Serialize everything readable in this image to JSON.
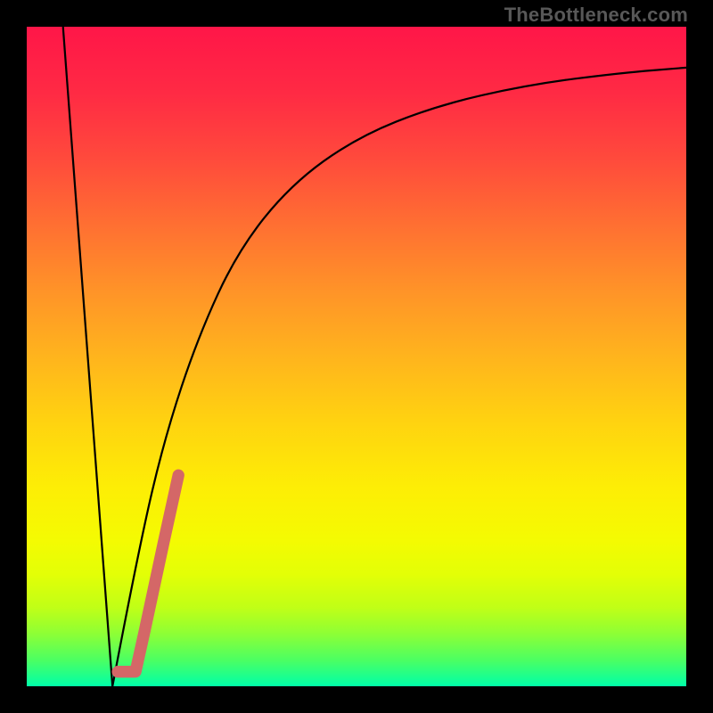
{
  "watermark": "TheBottleneck.com",
  "chart_data": {
    "type": "line",
    "title": "",
    "xlabel": "",
    "ylabel": "",
    "xlim": [
      0,
      1000
    ],
    "ylim": [
      0,
      1000
    ],
    "gradient_stops": [
      {
        "offset": 0.0,
        "color": "#ff1648"
      },
      {
        "offset": 0.1,
        "color": "#ff2a44"
      },
      {
        "offset": 0.2,
        "color": "#ff4a3c"
      },
      {
        "offset": 0.3,
        "color": "#ff6f32"
      },
      {
        "offset": 0.4,
        "color": "#ff9328"
      },
      {
        "offset": 0.5,
        "color": "#ffb41d"
      },
      {
        "offset": 0.6,
        "color": "#ffd310"
      },
      {
        "offset": 0.7,
        "color": "#fdee05"
      },
      {
        "offset": 0.78,
        "color": "#f4fb02"
      },
      {
        "offset": 0.83,
        "color": "#e3ff06"
      },
      {
        "offset": 0.88,
        "color": "#c1ff16"
      },
      {
        "offset": 0.92,
        "color": "#8eff35"
      },
      {
        "offset": 0.96,
        "color": "#4cff62"
      },
      {
        "offset": 1.0,
        "color": "#00ffa8"
      }
    ],
    "series": [
      {
        "name": "curve-left",
        "stroke": "#000000",
        "width": 3,
        "points": [
          {
            "x": 55,
            "y": 1000
          },
          {
            "x": 130,
            "y": 0
          }
        ]
      },
      {
        "name": "curve-right",
        "stroke": "#000000",
        "width": 3,
        "points": [
          {
            "x": 130,
            "y": 0
          },
          {
            "x": 170,
            "y": 210
          },
          {
            "x": 210,
            "y": 380
          },
          {
            "x": 260,
            "y": 530
          },
          {
            "x": 320,
            "y": 660
          },
          {
            "x": 400,
            "y": 760
          },
          {
            "x": 500,
            "y": 832
          },
          {
            "x": 620,
            "y": 880
          },
          {
            "x": 760,
            "y": 912
          },
          {
            "x": 900,
            "y": 930
          },
          {
            "x": 1000,
            "y": 938
          }
        ]
      },
      {
        "name": "highlight-segment",
        "stroke": "#d46767",
        "width": 18,
        "linecap": "round",
        "points": [
          {
            "x": 138,
            "y": 22
          },
          {
            "x": 165,
            "y": 22
          },
          {
            "x": 179,
            "y": 85
          },
          {
            "x": 208,
            "y": 220
          },
          {
            "x": 230,
            "y": 320
          }
        ]
      }
    ]
  }
}
